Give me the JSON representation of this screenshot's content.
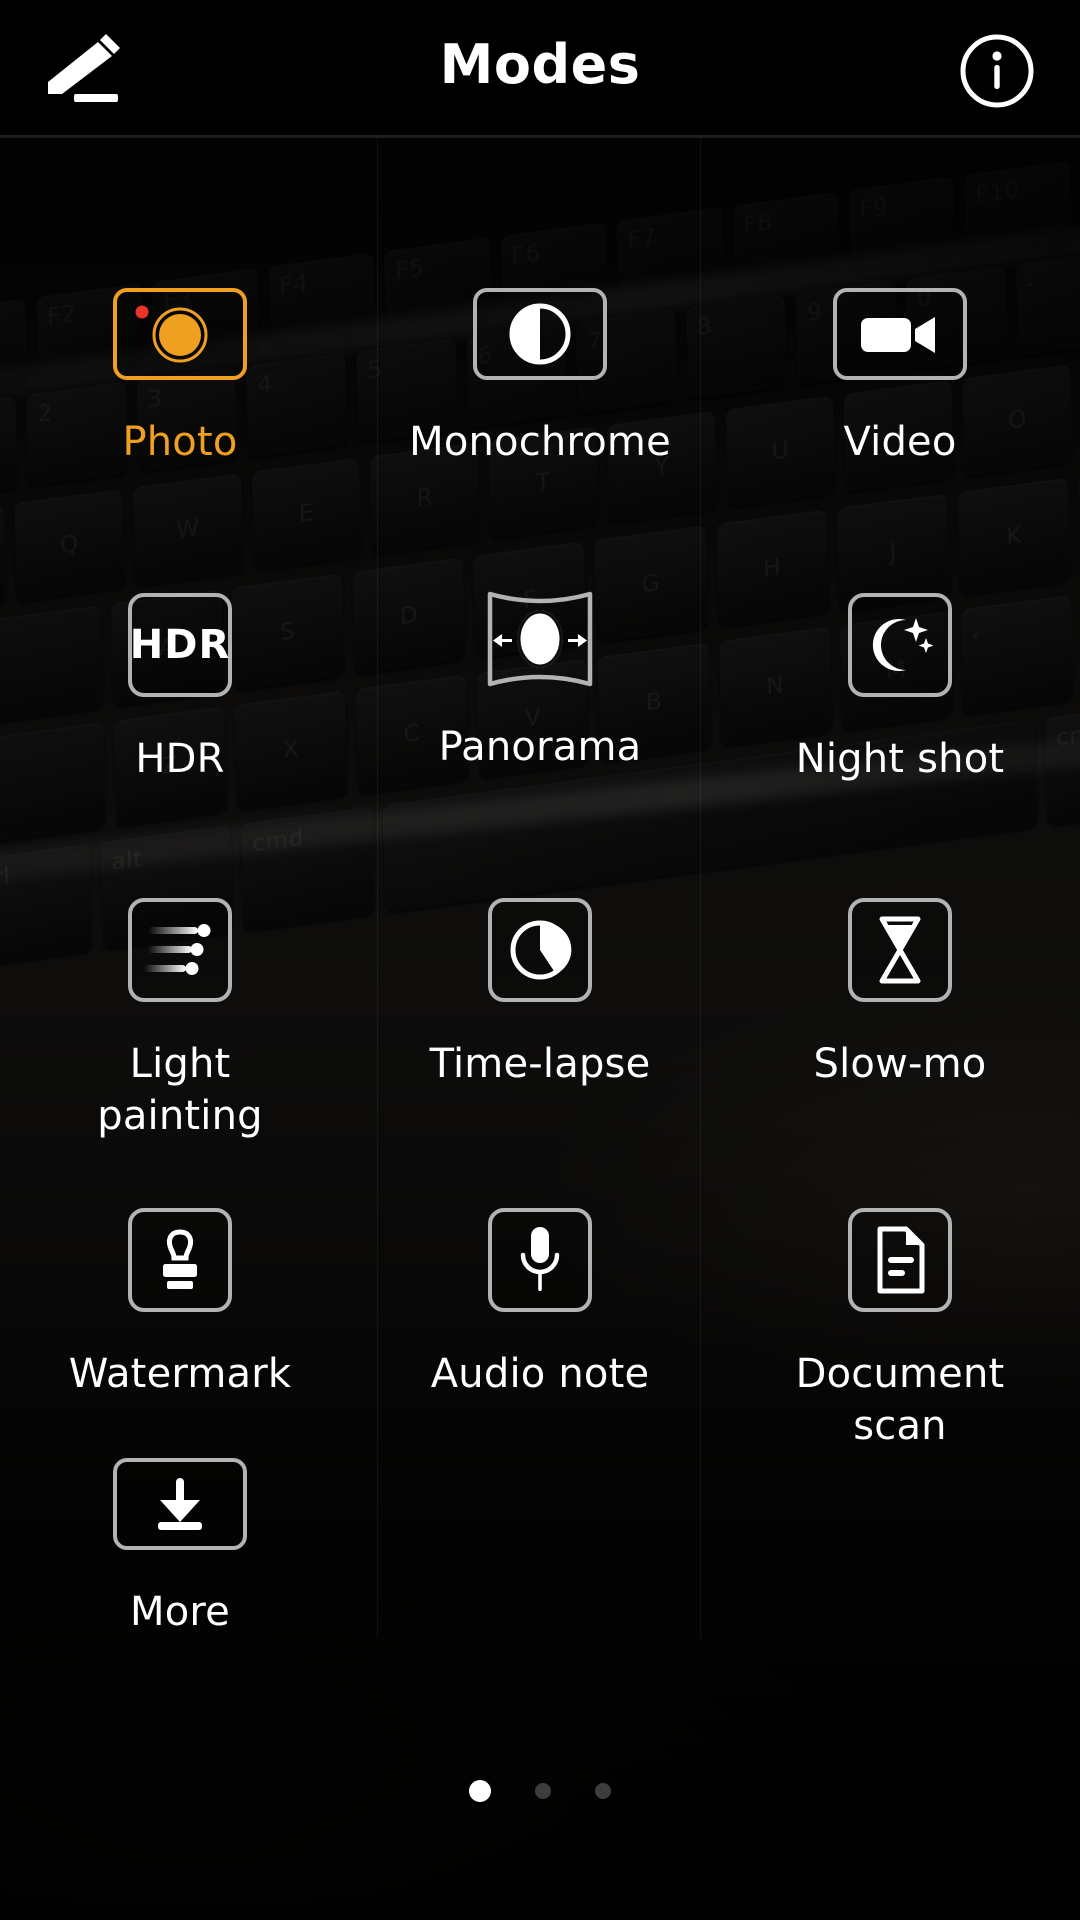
{
  "header": {
    "title": "Modes",
    "edit_icon": "pencil-edit-icon",
    "info_icon": "info-circle-icon"
  },
  "colors": {
    "accent": "#f0a020",
    "accent_dot": "#e8342a",
    "icon_stroke": "#ffffff",
    "tile_border": "#b3b3b3",
    "background": "#0b0b0b",
    "label": "#ffffff",
    "dot_active": "#ffffff",
    "dot_inactive": "#3d3d3d"
  },
  "modes": [
    {
      "id": "photo",
      "label": "Photo",
      "icon": "camera-icon",
      "selected": true
    },
    {
      "id": "monochrome",
      "label": "Monochrome",
      "icon": "contrast-icon",
      "selected": false
    },
    {
      "id": "video",
      "label": "Video",
      "icon": "video-camera-icon",
      "selected": false
    },
    {
      "id": "hdr",
      "label": "HDR",
      "icon": "hdr-text-icon",
      "selected": false,
      "icon_text": "HDR"
    },
    {
      "id": "panorama",
      "label": "Panorama",
      "icon": "panorama-icon",
      "selected": false
    },
    {
      "id": "night-shot",
      "label": "Night shot",
      "icon": "moon-stars-icon",
      "selected": false
    },
    {
      "id": "light-painting",
      "label": "Light\npainting",
      "icon": "light-streaks-icon",
      "selected": false
    },
    {
      "id": "time-lapse",
      "label": "Time-lapse",
      "icon": "pie-timer-icon",
      "selected": false
    },
    {
      "id": "slow-mo",
      "label": "Slow-mo",
      "icon": "hourglass-icon",
      "selected": false
    },
    {
      "id": "watermark",
      "label": "Watermark",
      "icon": "rubber-stamp-icon",
      "selected": false
    },
    {
      "id": "audio-note",
      "label": "Audio note",
      "icon": "microphone-icon",
      "selected": false
    },
    {
      "id": "document-scan",
      "label": "Document\nscan",
      "icon": "document-icon",
      "selected": false
    },
    {
      "id": "more",
      "label": "More",
      "icon": "download-arrow-icon",
      "selected": false
    }
  ],
  "pager": {
    "total": 3,
    "active_index": 0
  }
}
